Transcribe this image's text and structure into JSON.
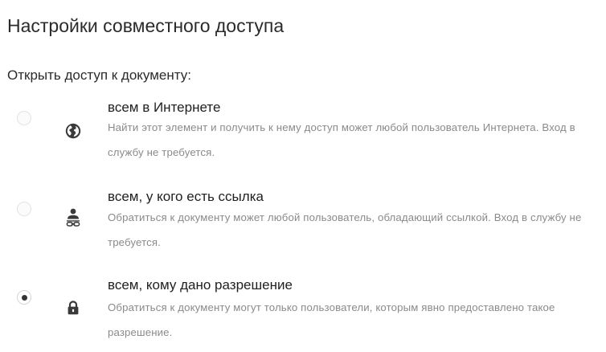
{
  "header": {
    "title": "Настройки совместного доступа",
    "subtitle": "Открыть доступ к документу:"
  },
  "options": [
    {
      "title": "всем в Интернете",
      "description": "Найти этот элемент и получить к нему доступ может любой пользователь Интернета. Вход в службу не требуется.",
      "icon": "globe-icon",
      "selected": false
    },
    {
      "title": "всем, у кого есть ссылка",
      "description": "Обратиться к документу может любой пользователь, обладающий ссылкой. Вход в службу не требуется.",
      "icon": "link-user-icon",
      "selected": false
    },
    {
      "title": "всем, кому дано разрешение",
      "description": "Обратиться к документу могут только пользователи, которым явно предоставлено такое разрешение.",
      "icon": "lock-icon",
      "selected": true
    }
  ]
}
